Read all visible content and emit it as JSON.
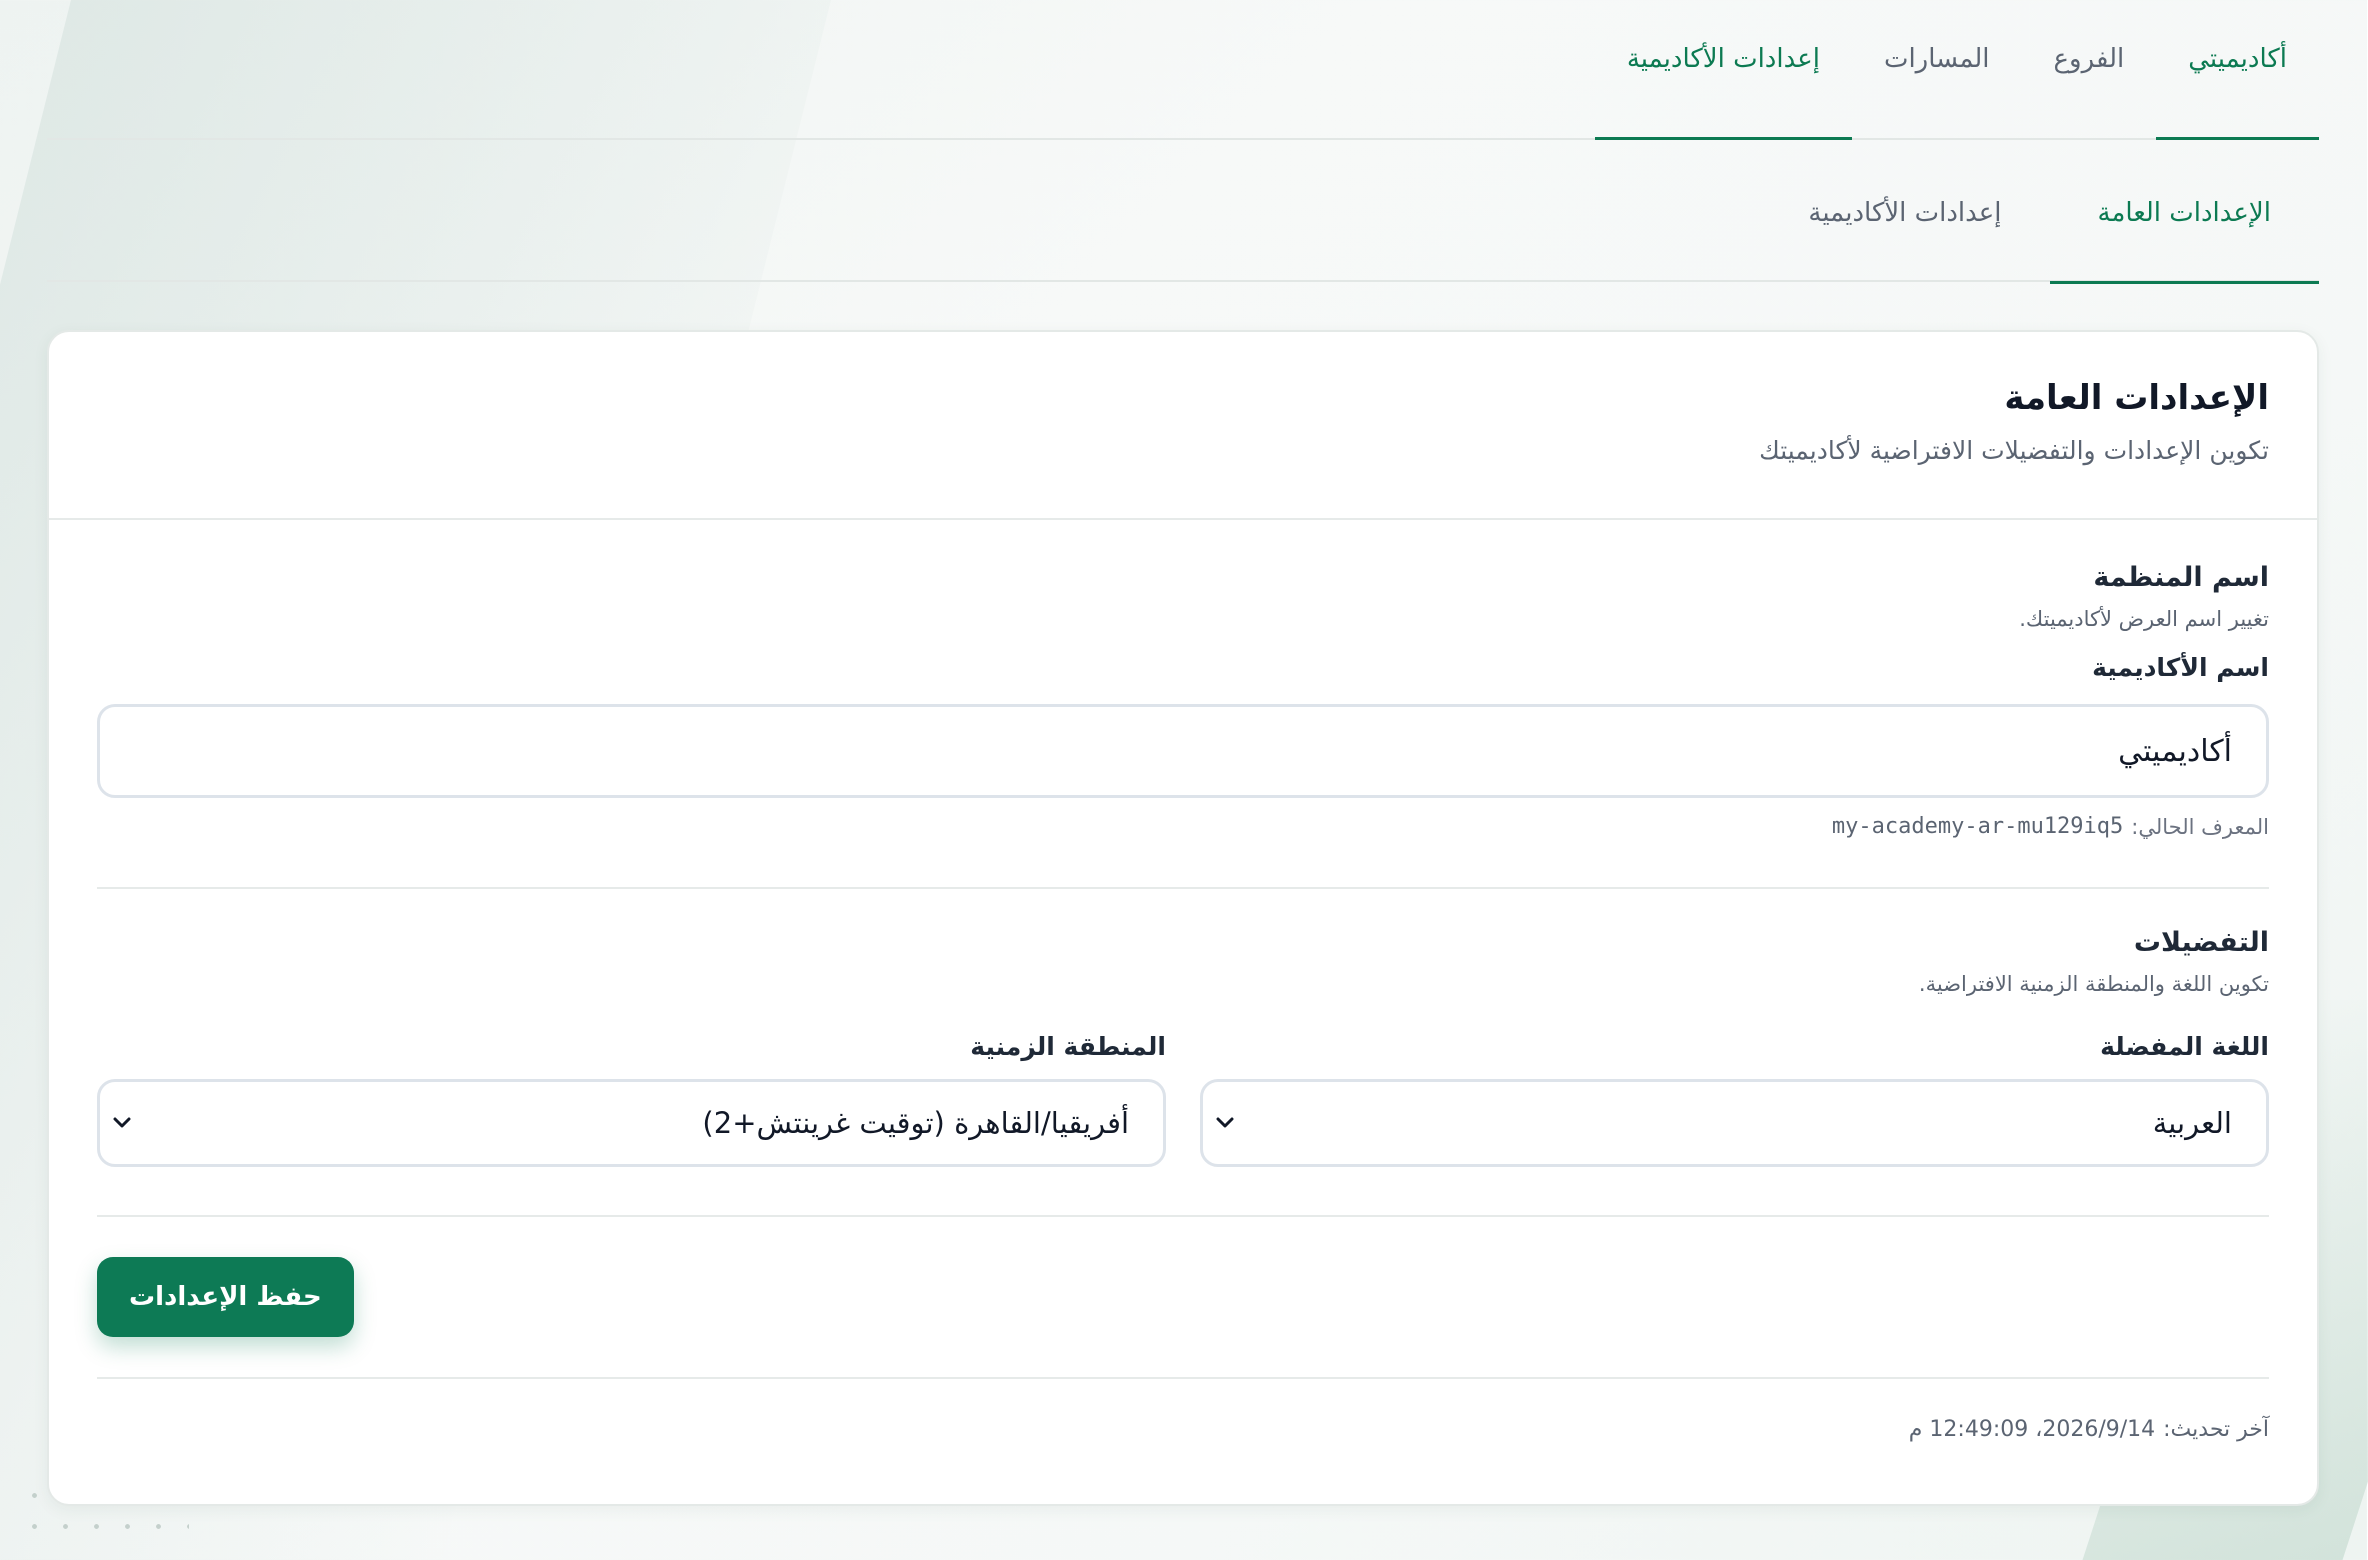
{
  "top_tabs": [
    {
      "label": "أكاديميتي",
      "active": true
    },
    {
      "label": "الفروع",
      "active": false
    },
    {
      "label": "المسارات",
      "active": false
    },
    {
      "label": "إعدادات الأكاديمية",
      "active": true
    }
  ],
  "sub_tabs": [
    {
      "label": "الإعدادات العامة",
      "active": true
    },
    {
      "label": "إعدادات الأكاديمية",
      "active": false
    }
  ],
  "card": {
    "title": "الإعدادات العامة",
    "subtitle": "تكوين الإعدادات والتفضيلات الافتراضية لأكاديميتك"
  },
  "organization": {
    "title": "اسم المنظمة",
    "description": "تغيير اسم العرض لأكاديميتك.",
    "field_label": "اسم الأكاديمية",
    "field_value": "أكاديميتي",
    "slug_label": "المعرف الحالي:",
    "slug_value": "my-academy-ar-mu129iq5"
  },
  "preferences": {
    "title": "التفضيلات",
    "description": "تكوين اللغة والمنطقة الزمنية الافتراضية.",
    "language_label": "اللغة المفضلة",
    "language_value": "العربية",
    "timezone_label": "المنطقة الزمنية",
    "timezone_value": "أفريقيا/القاهرة (توقيت غرينتش+2)"
  },
  "actions": {
    "save_label": "حفظ الإعدادات"
  },
  "footer": {
    "last_updated_label": "آخر تحديث:",
    "last_updated_value": "2026/9/14، 12:49:09 م"
  },
  "colors": {
    "accent": "#0c7a52",
    "button": "#0d7a55"
  },
  "icons": {
    "select_chevron": "chevron-down-icon"
  }
}
